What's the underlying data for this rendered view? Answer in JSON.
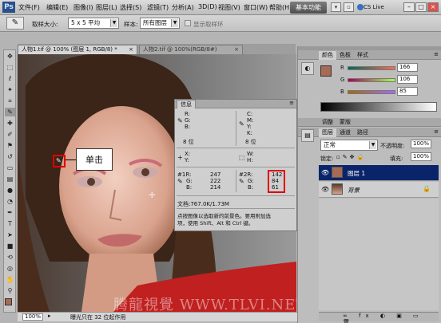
{
  "app": {
    "logo": "Ps",
    "workspace_button": "基本功能",
    "cslive": "CS Live"
  },
  "menu": [
    "文件(F)",
    "编辑(E)",
    "图像(I)",
    "图层(L)",
    "选择(S)",
    "滤镜(T)",
    "分析(A)",
    "3D(D)",
    "视图(V)",
    "窗口(W)",
    "帮助(H)"
  ],
  "options": {
    "sample_size_label": "取样大小:",
    "sample_size_value": "5 x 5 平均",
    "sample_label": "样本:",
    "sample_value": "所有图层",
    "show_ring_label": "显示取样环"
  },
  "tabs": [
    {
      "label": "人物1.tif @ 100% (图层 1, RGB/8) *",
      "close": "×"
    },
    {
      "label": "人物2.tif @ 100%(RGB/8#)",
      "close": "×"
    }
  ],
  "annotation": {
    "label": "单击"
  },
  "info_panel": {
    "tabs": [
      "信息"
    ],
    "rgb": {
      "r": "R:",
      "g": "G:",
      "b": "B:",
      "bit": "8 位"
    },
    "cmyk": {
      "c": "C:",
      "m": "M:",
      "y": "Y:",
      "k": "K:",
      "bit": "8 位"
    },
    "xy": {
      "x": "X:",
      "y": "Y:"
    },
    "wh": {
      "w": "W:",
      "h": "H:"
    },
    "sample1": {
      "r_label": "#1R:",
      "g_label": "G:",
      "b_label": "B:",
      "r": "247",
      "g": "222",
      "b": "214"
    },
    "sample2": {
      "r_label": "#2R:",
      "g_label": "G:",
      "b_label": "B:",
      "r": "142",
      "g": "84",
      "b": "61"
    },
    "doc": "文档:767.0K/1.73M",
    "hint_line1": "点按图像以选取新的前景色。要用附加选",
    "hint_line2": "项，使用 Shift、Alt 和 Ctrl 键。"
  },
  "status": {
    "zoom": "100%",
    "text": "曝光只在 32 位起作用"
  },
  "color_panel": {
    "tabs": [
      "颜色",
      "色板",
      "样式"
    ],
    "r_label": "R",
    "g_label": "G",
    "b_label": "B",
    "r": "166",
    "g": "106",
    "b": "85",
    "foreground": "#a66a55"
  },
  "layers_panel": {
    "tabs": [
      "图层",
      "通道",
      "路径"
    ],
    "mode": "正常",
    "opacity_label": "不透明度:",
    "opacity": "100%",
    "lock_label": "锁定:",
    "fill_label": "填充:",
    "fill": "100%",
    "layers": [
      {
        "name": "图层 1",
        "selected": true
      },
      {
        "name": "背景",
        "selected": false
      }
    ]
  },
  "adjust_tabs": [
    "调整",
    "蒙版"
  ],
  "watermark": "腾龍視覺 WWW.TLVI.NET",
  "colors": {
    "selected_layer": "#0a246a",
    "highlight": "#e00000"
  }
}
